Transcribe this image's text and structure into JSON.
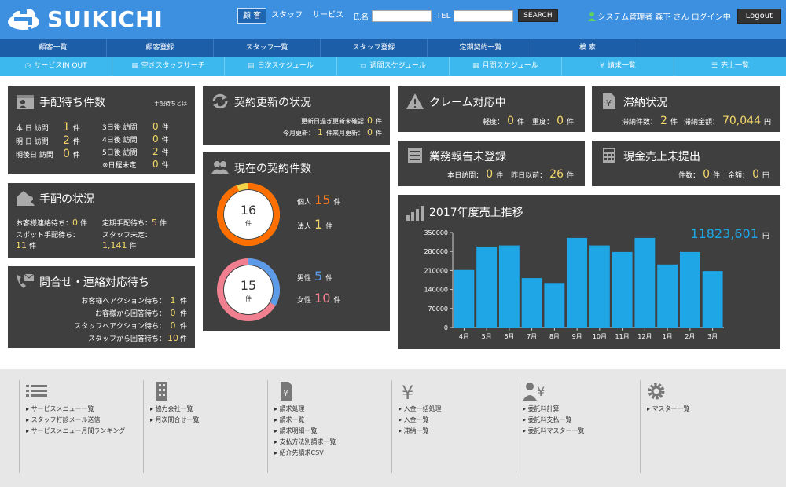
{
  "app": {
    "logo": "SUIKICHI"
  },
  "search": {
    "tab_customer": "顧 客",
    "tab_staff": "スタッフ",
    "tab_service": "サービス",
    "name_label": "氏名",
    "tel_label": "TEL",
    "name_value": "",
    "tel_value": "",
    "button": "SEARCH"
  },
  "user": {
    "text": "システム管理者 森下 さん ログイン中",
    "logout": "Logout"
  },
  "nav_primary": [
    "顧客一覧",
    "顧客登録",
    "スタッフ一覧",
    "スタッフ登録",
    "定期契約一覧",
    "検 索",
    ""
  ],
  "nav_secondary": [
    "サービスIN OUT",
    "空きスタッフサーチ",
    "日次スケジュール",
    "週間スケジュール",
    "月間スケジュール",
    "請求一覧",
    "売上一覧"
  ],
  "pending": {
    "title": "手配待ち件数",
    "help": "手配待ちとは",
    "rows_left": [
      [
        "本 日 訪問",
        "1",
        "件"
      ],
      [
        "明 日 訪問",
        "2",
        "件"
      ],
      [
        "明後日 訪問",
        "0",
        "件"
      ]
    ],
    "rows_right": [
      [
        "3日後 訪問",
        "0",
        "件"
      ],
      [
        "4日後 訪問",
        "0",
        "件"
      ],
      [
        "5日後 訪問",
        "2",
        "件"
      ],
      [
        "※日程未定",
        "0",
        "件"
      ]
    ]
  },
  "arrange": {
    "title": "手配の状況",
    "contact_label": "お客様連絡待ち：",
    "contact_value": "0",
    "contact_unit": "件",
    "regular_label": "定期手配待ち：",
    "regular_value": "5",
    "regular_unit": "件",
    "spot_label": "スポット手配待ち：",
    "spot_value": "11",
    "spot_unit": "件",
    "staff_label": "スタッフ未定：",
    "staff_value": "1,141",
    "staff_unit": "件"
  },
  "inquiry": {
    "title": "問合せ・連絡対応待ち",
    "rows": [
      [
        "お客様へアクション待ち：",
        "1",
        "件"
      ],
      [
        "お客様から回答待ち：",
        "0",
        "件"
      ],
      [
        "スタッフへアクション待ち：",
        "0",
        "件"
      ],
      [
        "スタッフから回答待ち：",
        "10",
        "件"
      ]
    ]
  },
  "renewal": {
    "title": "契約更新の状況",
    "row1_label": "更新日過ぎ更新未確認",
    "row1_value": "0",
    "row1_unit": "件",
    "row2a_label": "今月更新：",
    "row2a_value": "1",
    "row2a_unit": "件",
    "row2b_label": "来月更新：",
    "row2b_value": "0",
    "row2b_unit": "件"
  },
  "contracts": {
    "title": "現在の契約件数",
    "donut1": {
      "total": "16",
      "unit": "件",
      "individual_label": "個人",
      "individual_value": "15",
      "corporate_label": "法人",
      "corporate_value": "1",
      "item_unit": "件",
      "individual_fraction": 0.9375
    },
    "donut2": {
      "total": "15",
      "unit": "件",
      "male_label": "男性",
      "male_value": "5",
      "female_label": "女性",
      "female_value": "10",
      "item_unit": "件",
      "male_fraction": 0.3333
    }
  },
  "claim": {
    "title": "クレーム対応中",
    "light_label": "軽度：",
    "light_value": "0",
    "light_unit": "件",
    "heavy_label": "重度：",
    "heavy_value": "0",
    "heavy_unit": "件"
  },
  "arrears": {
    "title": "滞納状況",
    "count_label": "滞納件数：",
    "count_value": "2",
    "count_unit": "件",
    "amount_label": "滞納金額：",
    "amount_value": "70,044",
    "amount_unit": "円"
  },
  "report": {
    "title": "業務報告未登録",
    "today_label": "本日訪問：",
    "today_value": "0",
    "today_unit": "件",
    "before_label": "昨日以前：",
    "before_value": "26",
    "before_unit": "件"
  },
  "cash": {
    "title": "現金売上未提出",
    "count_label": "件数：",
    "count_value": "0",
    "count_unit": "件",
    "amount_label": "金額：",
    "amount_value": "0",
    "amount_unit": "円"
  },
  "sales": {
    "title": "2017年度売上推移",
    "total": "11823,601",
    "total_unit": "円"
  },
  "chart_data": {
    "type": "bar",
    "categories": [
      "4月",
      "5月",
      "6月",
      "7月",
      "8月",
      "9月",
      "10月",
      "11月",
      "12月",
      "1月",
      "2月",
      "3月"
    ],
    "values": [
      212000,
      298000,
      302000,
      182000,
      164000,
      330000,
      302000,
      278000,
      330000,
      232000,
      278000,
      208000
    ],
    "ylim": [
      0,
      350000
    ],
    "yticks": [
      0,
      70000,
      140000,
      210000,
      280000,
      350000
    ],
    "ytick_labels": [
      "0",
      "70000",
      "140000",
      "210000",
      "280000",
      "350000"
    ],
    "bar_color": "#1ea6e6",
    "grid": false
  },
  "footer": [
    {
      "icon": "list-icon",
      "links": [
        "サービスメニュー一覧",
        "スタッフ打診メール送信",
        "サービスメニュー月間ランキング"
      ]
    },
    {
      "icon": "building-icon",
      "links": [
        "協力会社一覧",
        "月次問合せ一覧"
      ]
    },
    {
      "icon": "invoice-icon",
      "links": [
        "請求処理",
        "請求一覧",
        "請求明細一覧",
        "支払方法別請求一覧",
        "紹介先請求CSV"
      ]
    },
    {
      "icon": "yen-icon",
      "links": [
        "入金一括処理",
        "入金一覧",
        "滞納一覧"
      ]
    },
    {
      "icon": "person-yen-icon",
      "links": [
        "委託料計算",
        "委託料支払一覧",
        "委託料マスター一覧"
      ]
    },
    {
      "icon": "gear-icon",
      "links": [
        "マスター一覧"
      ]
    }
  ]
}
